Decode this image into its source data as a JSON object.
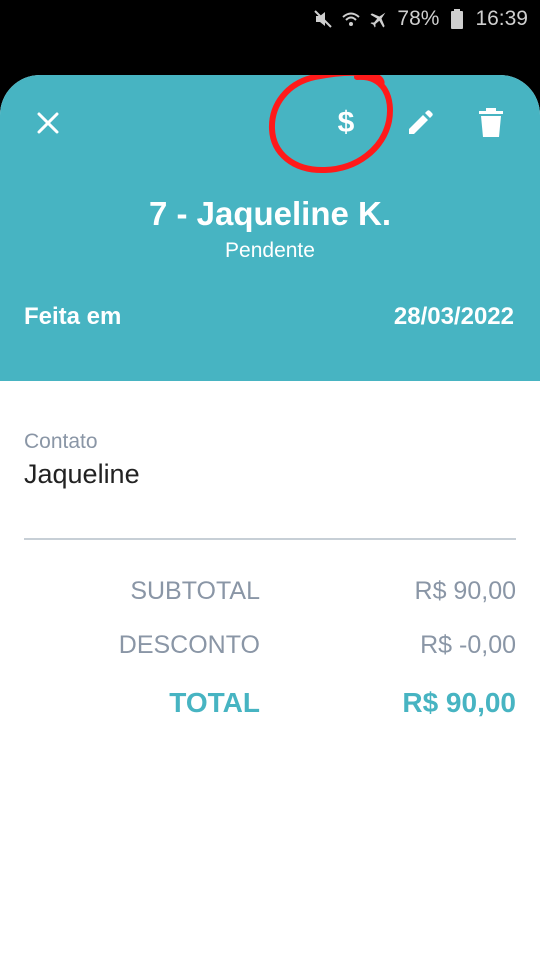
{
  "status_bar": {
    "battery": "78%",
    "time": "16:39",
    "icons": [
      "mute-icon",
      "wifi-icon",
      "airplane-icon",
      "battery-icon"
    ]
  },
  "header": {
    "title": "7 - Jaqueline K.",
    "status": "Pendente",
    "made_label": "Feita em",
    "made_date": "28/03/2022",
    "dollar_symbol": "$",
    "accent_color": "#47b4c2",
    "annotation_color": "#ff1a1a"
  },
  "contact": {
    "label": "Contato",
    "value": "Jaqueline"
  },
  "totals": {
    "subtotal_label": "SUBTOTAL",
    "subtotal_value": "R$ 90,00",
    "discount_label": "DESCONTO",
    "discount_value": "R$ -0,00",
    "total_label": "TOTAL",
    "total_value": "R$ 90,00"
  }
}
